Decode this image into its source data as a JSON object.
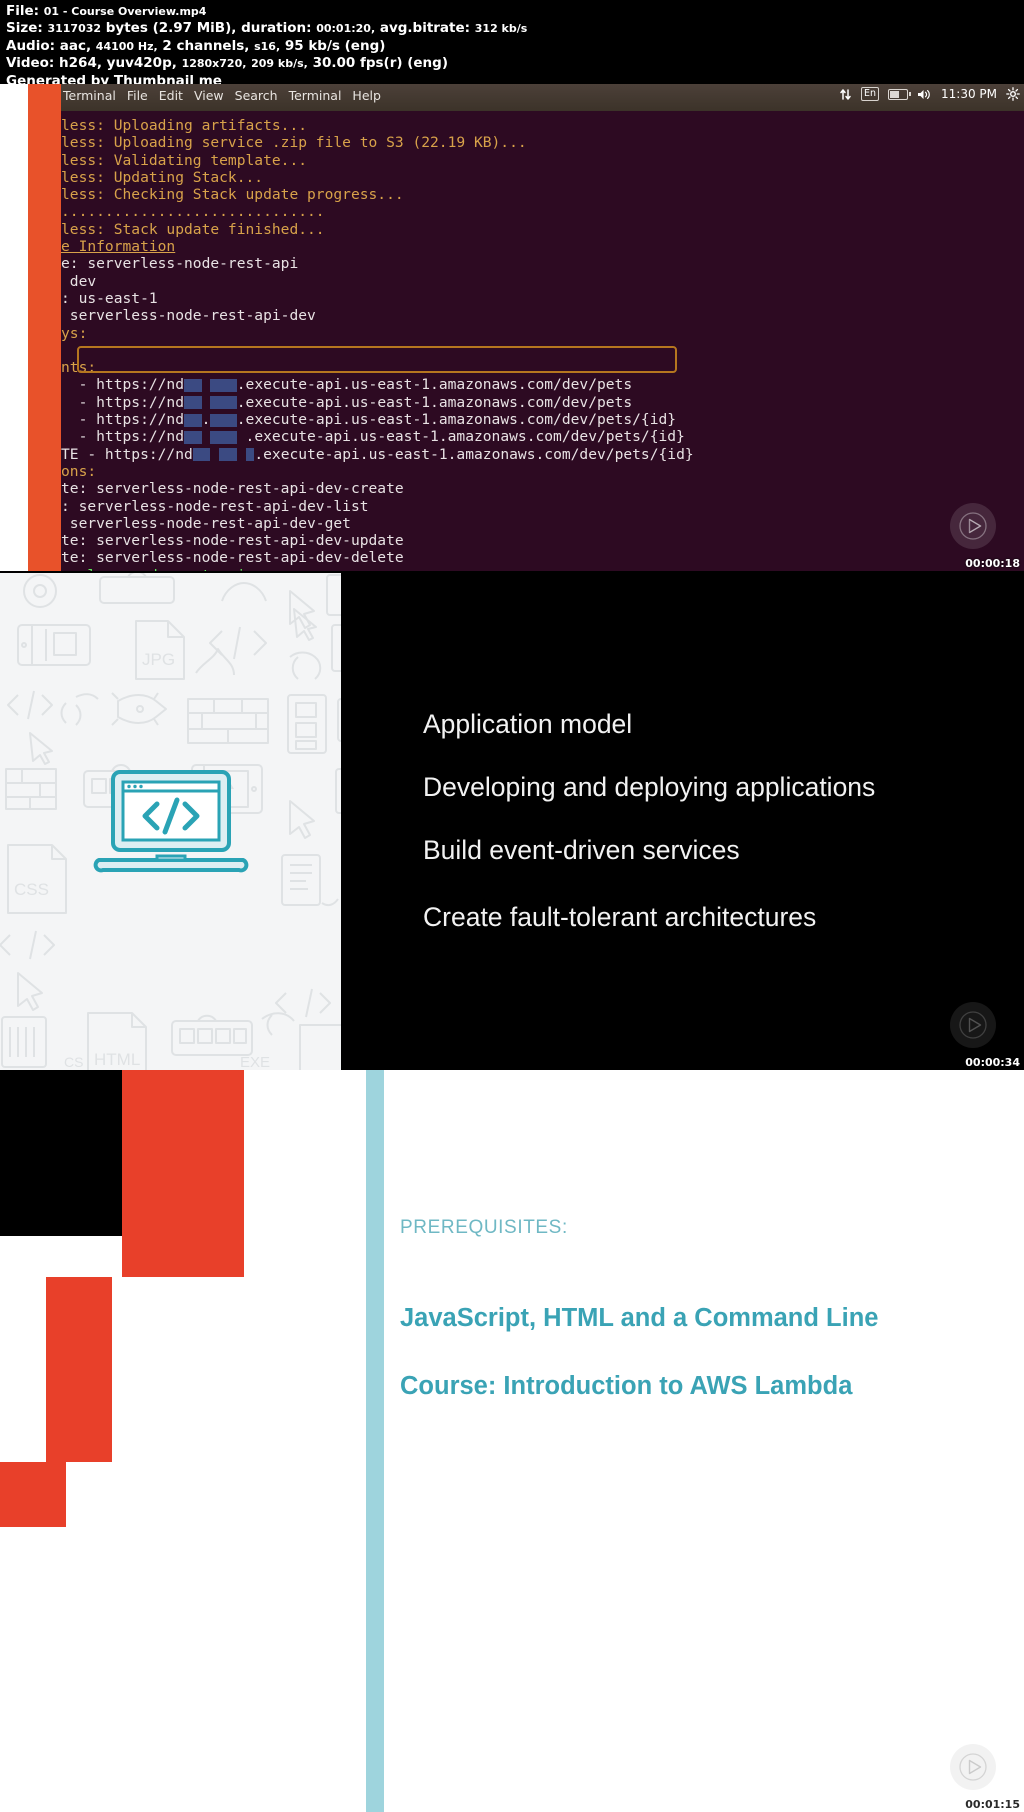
{
  "meta": {
    "file_label": "File:",
    "file_name": "01 - Course Overview.mp4",
    "size_label": "Size:",
    "size_bytes": "3117032",
    "size_unit": "bytes",
    "size_human": "(2.97 MiB),",
    "duration_label": "duration:",
    "duration": "00:01:20,",
    "bitrate_label": "avg.bitrate:",
    "bitrate": "312 kb/s",
    "audio_label": "Audio:",
    "audio_codec": "aac,",
    "audio_rate": "44100 Hz,",
    "audio_channels": "2 channels,",
    "audio_fmt": "s16,",
    "audio_bitrate": "95 kb/s (eng)",
    "video_label": "Video:",
    "video_codec": "h264,",
    "video_pixfmt": "yuv420p,",
    "video_res": "1280x720,",
    "video_bitrate": "209 kb/s,",
    "video_fps": "30.00 fps(r) (eng)",
    "generator": "Generated by Thumbnail me"
  },
  "panel1": {
    "type": "terminal-screenshot",
    "timecode": "00:00:18",
    "menu": [
      "Terminal",
      "File",
      "Edit",
      "View",
      "Search",
      "Terminal",
      "Help"
    ],
    "tray": {
      "network_icon": "network-updown-icon",
      "language": "En",
      "battery_icon": "battery-icon",
      "volume_icon": "volume-icon",
      "clock": "11:30 PM",
      "gear_icon": "gear-icon"
    },
    "lines": [
      {
        "text": "less: Uploading artifacts...",
        "color": "orange"
      },
      {
        "text": "less: Uploading service .zip file to S3 (22.19 KB)...",
        "color": "orange"
      },
      {
        "text": "less: Validating template...",
        "color": "orange"
      },
      {
        "text": "less: Updating Stack...",
        "color": "orange"
      },
      {
        "text": "less: Checking Stack update progress...",
        "color": "orange"
      },
      {
        "text": "..............................",
        "color": "orange"
      },
      {
        "text": "less: Stack update finished...",
        "color": "orange"
      },
      {
        "text": "e Information",
        "color": "orange",
        "underline": true
      },
      {
        "text": "e: serverless-node-rest-api",
        "color": "white"
      },
      {
        "text": " dev",
        "color": "white"
      },
      {
        "text": ": us-east-1",
        "color": "white"
      },
      {
        "text": " serverless-node-rest-api-dev",
        "color": "white"
      },
      {
        "text": "ys:",
        "color": "orange"
      },
      {
        "text": "",
        "color": "white"
      },
      {
        "text": "nts:",
        "color": "orange"
      },
      {
        "text": "  - https://nd██ ███.execute-api.us-east-1.amazonaws.com/dev/pets",
        "color": "white"
      },
      {
        "text": "  - https://nd██ ███.execute-api.us-east-1.amazonaws.com/dev/pets",
        "color": "white"
      },
      {
        "text": "  - https://nd██.███.execute-api.us-east-1.amazonaws.com/dev/pets/{id}",
        "color": "white"
      },
      {
        "text": "  - https://nd██ ███ .execute-api.us-east-1.amazonaws.com/dev/pets/{id}",
        "color": "white"
      },
      {
        "text": "TE - https://nd██ ██ █.execute-api.us-east-1.amazonaws.com/dev/pets/{id}",
        "color": "white"
      },
      {
        "text": "ons:",
        "color": "orange"
      },
      {
        "text": "te: serverless-node-rest-api-dev-create",
        "color": "white"
      },
      {
        "text": ": serverless-node-rest-api-dev-list",
        "color": "white"
      },
      {
        "text": " serverless-node-rest-api-dev-get",
        "color": "white"
      },
      {
        "text": "te: serverless-node-rest-api-dev-update",
        "color": "white"
      },
      {
        "text": "te: serverless-node-rest-api-dev-delete",
        "color": "white"
      },
      {
        "text": "verless-node-rest-api ",
        "color": "green"
      }
    ]
  },
  "panel2": {
    "type": "slide-bullets",
    "timecode": "00:00:34",
    "accent_color": "#26a9bf",
    "background": "#000000",
    "bullets": [
      "Application model",
      "Developing and deploying applications",
      "Build event-driven services",
      "Create fault-tolerant architectures"
    ],
    "iconwall_labels": [
      "JPG",
      "CSS",
      "HTML",
      "EXE",
      "CS"
    ],
    "laptop_icon": "laptop-code-icon"
  },
  "panel3": {
    "type": "slide-prerequisites",
    "timecode": "00:01:15",
    "accent_color": "#9ed4dd",
    "red_color": "#e8402a",
    "kicker": "PREREQUISITES:",
    "headings": [
      "JavaScript, HTML and a Command Line",
      "Course: Introduction to AWS Lambda"
    ]
  }
}
